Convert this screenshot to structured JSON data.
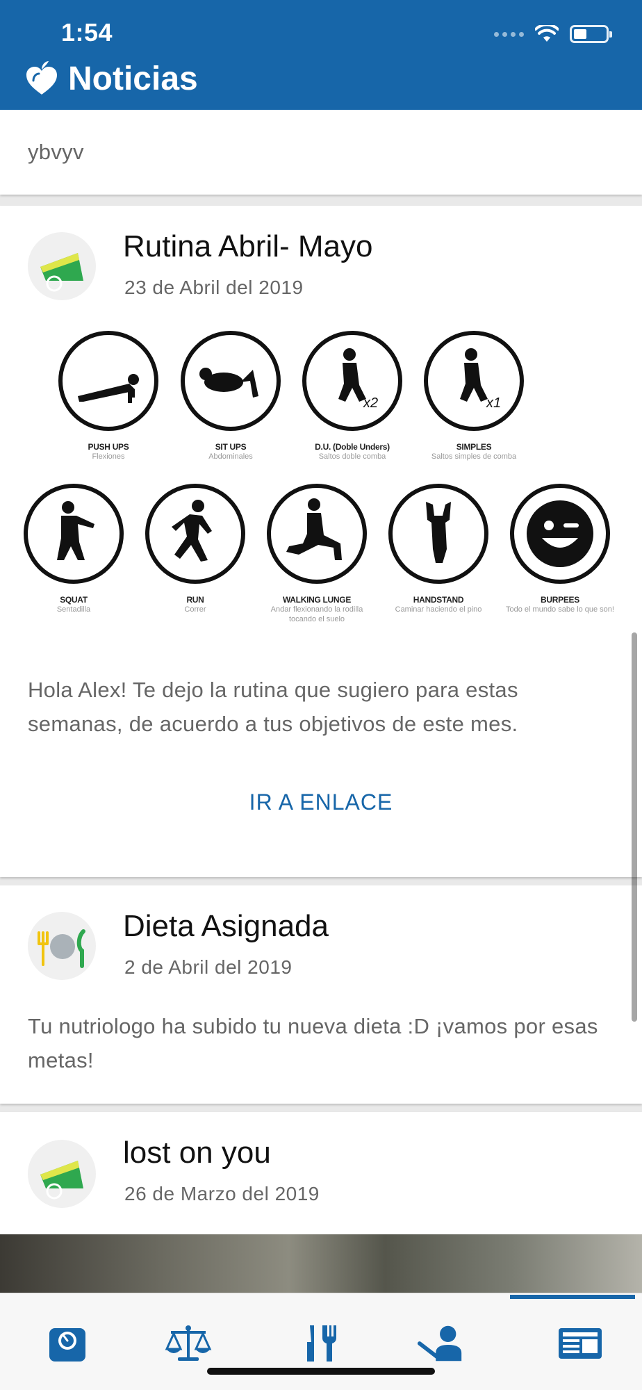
{
  "status_bar": {
    "time": "1:54"
  },
  "header": {
    "title": "Noticias",
    "logo_icon": "apple-heart-logo-icon"
  },
  "cards": [
    {
      "body": "ybvyv"
    },
    {
      "title": "Rutina Abril- Mayo",
      "date": "23 de Abril del 2019",
      "avatar_icon": "scale-icon",
      "body": "Hola Alex! Te dejo la rutina que sugiero para estas semanas, de acuerdo a tus objetivos de este mes.",
      "link_label": "IR A ENLACE",
      "exercises": [
        {
          "name": "PUSH UPS",
          "desc": "Flexiones"
        },
        {
          "name": "SIT UPS",
          "desc": "Abdominales"
        },
        {
          "name": "D.U. (Doble Unders)",
          "desc": "Saltos doble comba"
        },
        {
          "name": "SIMPLES",
          "desc": "Saltos simples de comba"
        },
        {
          "name": "SQUAT",
          "desc": "Sentadilla"
        },
        {
          "name": "RUN",
          "desc": "Correr"
        },
        {
          "name": "WALKING LUNGE",
          "desc": "Andar flexionando la rodilla tocando el suelo"
        },
        {
          "name": "HANDSTAND",
          "desc": "Caminar haciendo el pino"
        },
        {
          "name": "BURPEES",
          "desc": "Todo el mundo sabe lo que son!"
        }
      ]
    },
    {
      "title": "Dieta Asignada",
      "date": "2 de Abril del 2019",
      "avatar_icon": "plate-cutlery-icon",
      "body": "Tu nutriologo ha subido tu nueva dieta :D ¡vamos por esas metas!"
    },
    {
      "title": "lost on you",
      "date": "26 de Marzo del 2019",
      "avatar_icon": "scale-icon"
    }
  ],
  "bottom_nav": {
    "items": [
      "dashboard-scale-icon",
      "balance-scale-icon",
      "cutlery-icon",
      "trainer-icon",
      "news-icon"
    ],
    "active": "news-icon"
  },
  "colors": {
    "brand": "#1766a9",
    "background": "#e9e9e9"
  }
}
